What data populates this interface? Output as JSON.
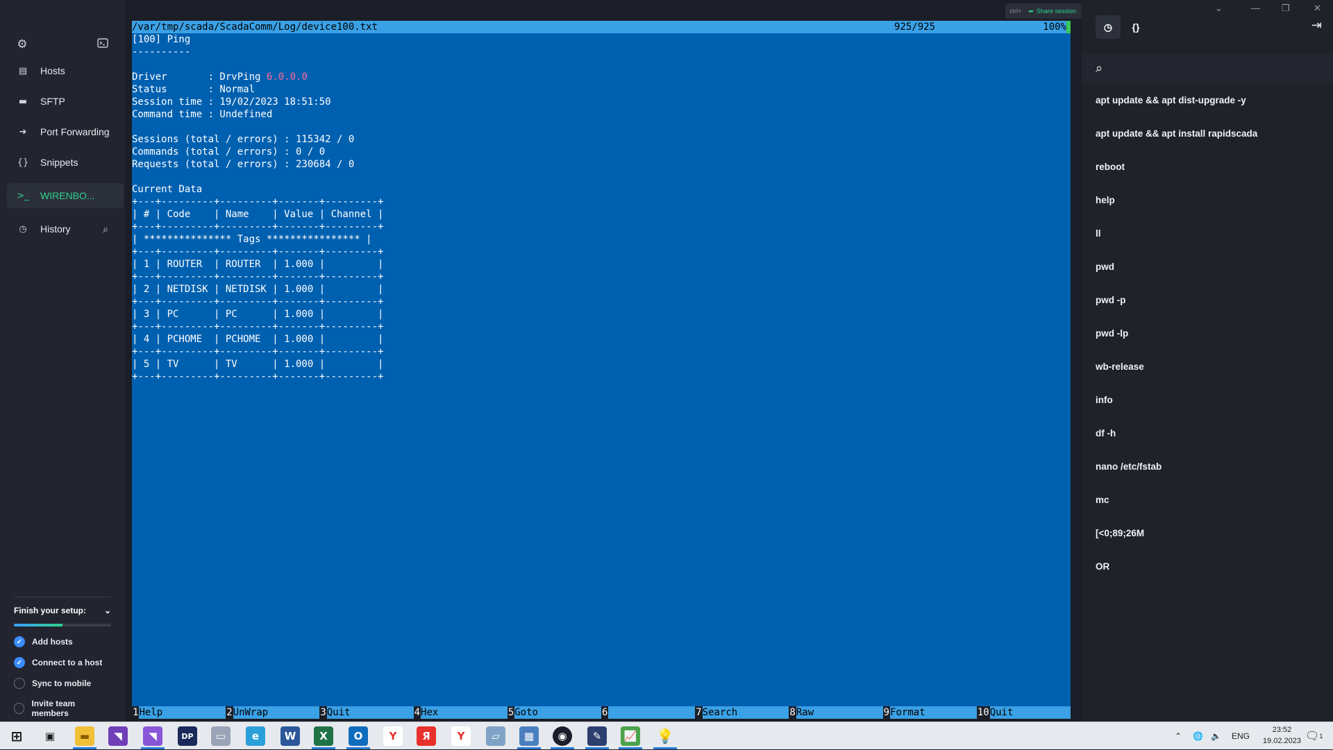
{
  "sidebar": {
    "items": [
      {
        "label": "Hosts"
      },
      {
        "label": "SFTP"
      },
      {
        "label": "Port Forwarding"
      },
      {
        "label": "Snippets"
      },
      {
        "label": "WIRENBO..."
      },
      {
        "label": "History"
      }
    ],
    "setup": {
      "title": "Finish your setup:",
      "progress": 0.5,
      "tasks": [
        {
          "label": "Add hosts",
          "done": true
        },
        {
          "label": "Connect to a host",
          "done": true
        },
        {
          "label": "Sync to mobile",
          "done": false
        },
        {
          "label": "Invite team members",
          "done": false
        }
      ]
    }
  },
  "terminal": {
    "file_path": "/var/tmp/scada/ScadaComm/Log/device100.txt",
    "line_position": "925/925",
    "percent": "100%",
    "share_label": "Share session",
    "share_kbd": "ctrl+",
    "lines": [
      "[100] Ping",
      "----------",
      "",
      "Driver       : DrvPing ",
      "Status       : Normal",
      "Session time : 19/02/2023 18:51:50",
      "Command time : Undefined",
      "",
      "Sessions (total / errors) : 115342 / 0",
      "Commands (total / errors) : 0 / 0",
      "Requests (total / errors) : 230684 / 0",
      "",
      "Current Data",
      "+---+---------+---------+-------+---------+",
      "| # | Code    | Name    | Value | Channel |",
      "+---+---------+---------+-------+---------+",
      "| *************** Tags **************** |",
      "+---+---------+---------+-------+---------+",
      "| 1 | ROUTER  | ROUTER  | 1.000 |         |",
      "+---+---------+---------+-------+---------+",
      "| 2 | NETDISK | NETDISK | 1.000 |         |",
      "+---+---------+---------+-------+---------+",
      "| 3 | PC      | PC      | 1.000 |         |",
      "+---+---------+---------+-------+---------+",
      "| 4 | PCHOME  | PCHOME  | 1.000 |         |",
      "+---+---------+---------+-------+---------+",
      "| 5 | TV      | TV      | 1.000 |         |",
      "+---+---------+---------+-------+---------+"
    ],
    "driver_version": "6.0.0.0",
    "function_keys": [
      {
        "num": "1",
        "label": "Help"
      },
      {
        "num": "2",
        "label": "UnWrap"
      },
      {
        "num": "3",
        "label": "Quit"
      },
      {
        "num": "4",
        "label": "Hex"
      },
      {
        "num": "5",
        "label": "Goto"
      },
      {
        "num": "6",
        "label": ""
      },
      {
        "num": "7",
        "label": "Search"
      },
      {
        "num": "8",
        "label": "Raw"
      },
      {
        "num": "9",
        "label": "Format"
      },
      {
        "num": "10",
        "label": "Quit"
      }
    ]
  },
  "history": {
    "commands": [
      "apt update && apt dist-upgrade -y",
      "apt update && apt install rapidscada",
      "reboot",
      "help",
      "ll",
      "pwd",
      "pwd -p",
      "pwd -lp",
      "wb-release",
      "info",
      "df -h",
      "nano /etc/fstab",
      "mc",
      "[<0;89;26M",
      "OR"
    ]
  },
  "taskbar": {
    "language": "ENG",
    "time": "23:52",
    "date": "19.02.2023",
    "notification_count": "1"
  }
}
